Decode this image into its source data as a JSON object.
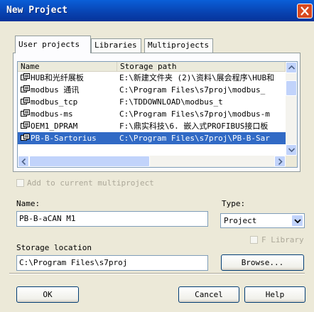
{
  "window": {
    "title": "New Project"
  },
  "tabs": [
    {
      "label": "User projects"
    },
    {
      "label": "Libraries"
    },
    {
      "label": "Multiprojects"
    }
  ],
  "list": {
    "columns": [
      "Name",
      "Storage path"
    ],
    "rows": [
      {
        "name": "HUB和光纤展板",
        "path": "E:\\新建文件夹 (2)\\资料\\展会程序\\HUB和"
      },
      {
        "name": "modbus 通讯",
        "path": "C:\\Program Files\\s7proj\\modbus_"
      },
      {
        "name": "modbus_tcp",
        "path": "F:\\TDDOWNLOAD\\modbus_t"
      },
      {
        "name": "modbus-ms",
        "path": "C:\\Program Files\\s7proj\\modbus-m"
      },
      {
        "name": "OEM1_DPRAM",
        "path": "F:\\鼎实科技\\6.  嵌入式PROFIBUS接口板"
      },
      {
        "name": "PB-B-Sartorius",
        "path": "C:\\Program Files\\s7proj\\PB-B-Sar"
      }
    ],
    "selected_row": 5
  },
  "form": {
    "add_to_multiproject_label": "Add to current multiproject",
    "name_label": "Name:",
    "name_value": "PB-B-aCAN M1",
    "type_label": "Type:",
    "type_value": "Project",
    "f_library_label": "F Library",
    "storage_location_label": "Storage location",
    "storage_location_value": "C:\\Program Files\\s7proj",
    "browse_label": "Browse..."
  },
  "buttons": {
    "ok": "OK",
    "cancel": "Cancel",
    "help": "Help"
  },
  "colors": {
    "titlebar": "#0842b0",
    "close_button": "#d9491f",
    "selection": "#316ac5",
    "dialog_background": "#ece9d8"
  },
  "icons": {
    "project": "project-icon",
    "close": "close-icon"
  }
}
